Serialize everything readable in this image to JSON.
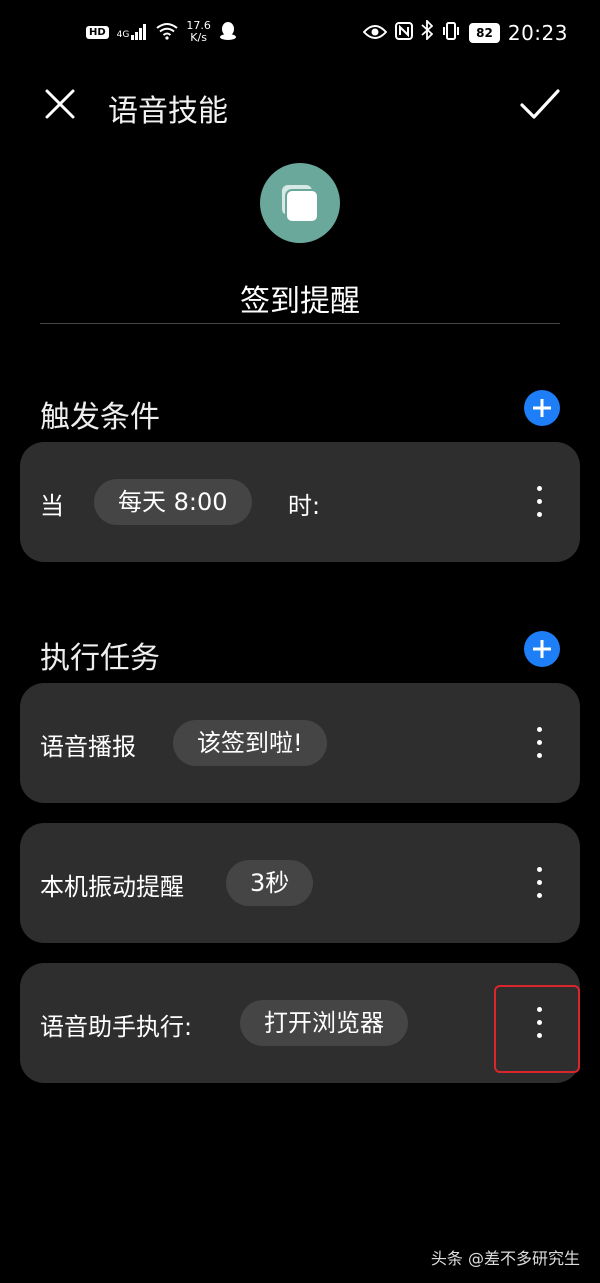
{
  "statusbar": {
    "hd": "HD",
    "network": "4G",
    "speed_value": "17.6",
    "speed_unit": "K/s",
    "battery": "82",
    "time": "20:23"
  },
  "header": {
    "title": "语音技能"
  },
  "skill": {
    "name": "签到提醒",
    "icon": "copy-icon",
    "icon_color": "#6aa89c"
  },
  "trigger": {
    "section_title": "触发条件",
    "card": {
      "prefix": "当",
      "chip": "每天 8:00",
      "suffix": "时:"
    }
  },
  "tasks": {
    "section_title": "执行任务",
    "items": [
      {
        "label": "语音播报",
        "chip": "该签到啦!"
      },
      {
        "label": "本机振动提醒",
        "chip": "3秒"
      },
      {
        "label": "语音助手执行:",
        "chip": "打开浏览器"
      }
    ]
  },
  "colors": {
    "accent": "#1e7ef7",
    "card_bg": "#2e2e2e",
    "chip_bg": "#454545",
    "highlight": "#d8262c"
  },
  "watermark": "头条 @差不多研究生"
}
